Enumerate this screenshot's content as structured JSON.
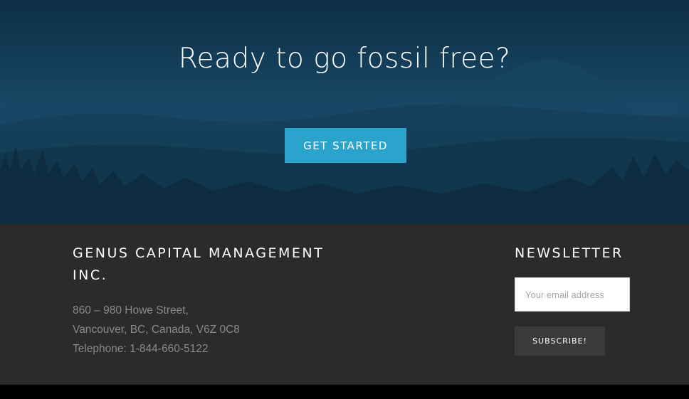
{
  "hero": {
    "title": "Ready to go fossil free?",
    "cta_label": "GET STARTED"
  },
  "footer": {
    "company_name": "GENUS CAPITAL MANAGEMENT INC.",
    "address_lines": [
      "860 – 980 Howe Street,",
      "Vancouver, BC, Canada, V6Z 0C8",
      "Telephone: 1-844-660-5122"
    ],
    "newsletter": {
      "title": "NEWSLETTER",
      "email_placeholder": "Your email address",
      "subscribe_label": "SUBSCRIBE!"
    }
  },
  "colors": {
    "hero_overlay": "#1a4762",
    "accent": "#2aa4cc",
    "footer_bg": "#2b2b2b",
    "subscribe_bg": "#3b3b3b"
  }
}
